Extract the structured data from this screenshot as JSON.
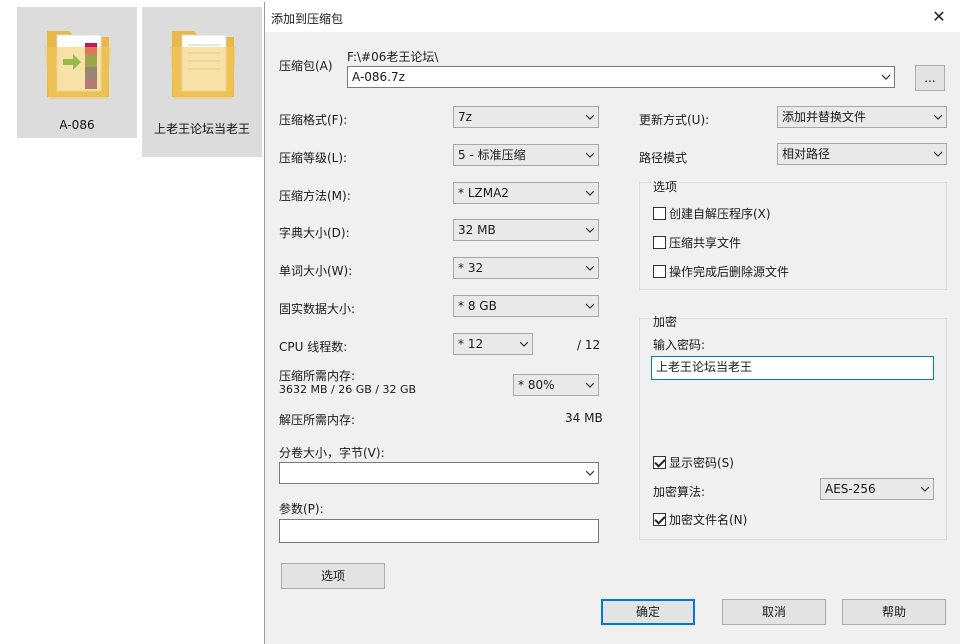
{
  "desktop": {
    "icons": [
      {
        "label": "A-086",
        "icon": "winrar-archive-icon"
      },
      {
        "label": "上老王论坛当老王",
        "icon": "folder-icon"
      }
    ]
  },
  "dialog": {
    "title": "添加到压缩包",
    "archive": {
      "label": "压缩包(A)",
      "path": "F:\\#06老王论坛\\",
      "value": "A-086.7z",
      "browse_label": "..."
    },
    "left": {
      "format": {
        "label": "压缩格式(F):",
        "value": "7z"
      },
      "level": {
        "label": "压缩等级(L):",
        "value": "5 - 标准压缩"
      },
      "method": {
        "label": "压缩方法(M):",
        "value": "* LZMA2"
      },
      "dict": {
        "label": "字典大小(D):",
        "value": "32 MB"
      },
      "word": {
        "label": "单词大小(W):",
        "value": "* 32"
      },
      "solid": {
        "label": "固实数据大小:",
        "value": "* 8 GB"
      },
      "threads": {
        "label": "CPU 线程数:",
        "value": "* 12",
        "max": "/ 12"
      },
      "mem_compress": {
        "label": "压缩所需内存:",
        "detail": "3632 MB / 26 GB / 32 GB",
        "value": "* 80%"
      },
      "mem_decompress": {
        "label": "解压所需内存:",
        "value": "34 MB"
      },
      "split": {
        "label": "分卷大小，字节(V):",
        "value": ""
      },
      "params": {
        "label": "参数(P):",
        "value": ""
      },
      "options_button": "选项"
    },
    "right": {
      "update": {
        "label": "更新方式(U):",
        "value": "添加并替换文件"
      },
      "path_mode": {
        "label": "路径模式",
        "value": "相对路径"
      },
      "options": {
        "title": "选项",
        "sfx": "创建自解压程序(X)",
        "shared": "压缩共享文件",
        "delete": "操作完成后删除源文件"
      },
      "encryption": {
        "title": "加密",
        "password_label": "输入密码:",
        "password_value": "上老王论坛当老王",
        "show_password": "显示密码(S)",
        "method_label": "加密算法:",
        "method_value": "AES-256",
        "encrypt_names": "加密文件名(N)"
      }
    },
    "buttons": {
      "ok": "确定",
      "cancel": "取消",
      "help": "帮助"
    }
  }
}
